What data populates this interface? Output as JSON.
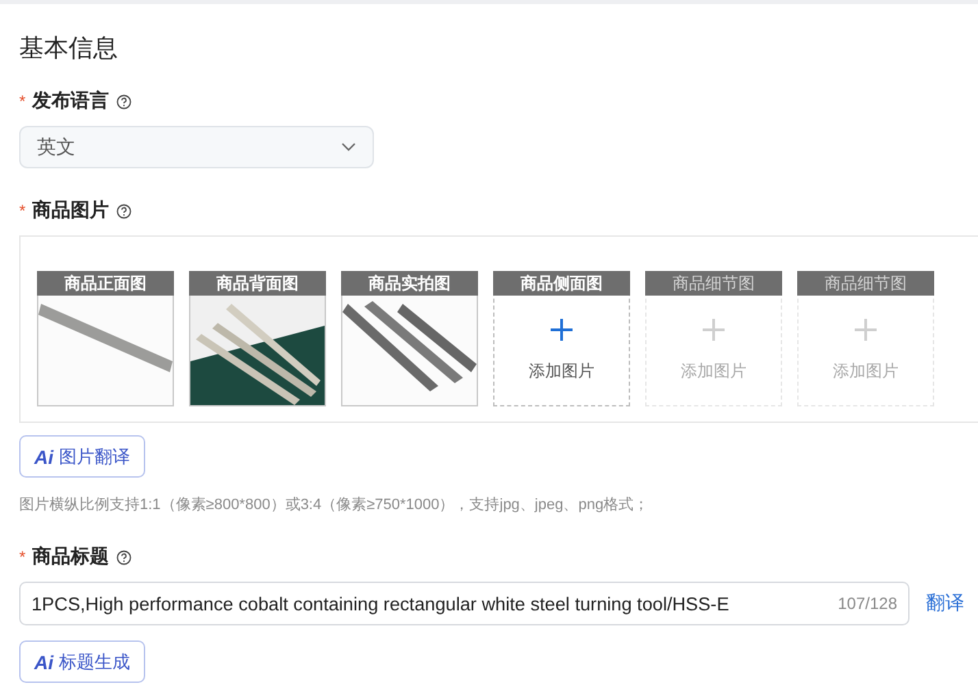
{
  "section_title": "基本信息",
  "language": {
    "mark": "*",
    "label": "发布语言",
    "value": "英文"
  },
  "images": {
    "mark": "*",
    "label": "商品图片",
    "slots": [
      {
        "caption": "商品正面图"
      },
      {
        "caption": "商品背面图"
      },
      {
        "caption": "商品实拍图"
      },
      {
        "caption": "商品侧面图",
        "kind": "empty",
        "add_label": "添加图片",
        "disabled": false
      },
      {
        "caption": "商品细节图",
        "kind": "empty",
        "add_label": "添加图片",
        "disabled": true
      },
      {
        "caption": "商品细节图",
        "kind": "empty",
        "add_label": "添加图片",
        "disabled": true
      }
    ],
    "ai_button": {
      "badge": "Ai",
      "label": "图片翻译"
    },
    "hint": "图片横纵比例支持1:1（像素≥800*800）或3:4（像素≥750*1000），支持jpg、jpeg、png格式；"
  },
  "title": {
    "mark": "*",
    "label": "商品标题",
    "value": "1PCS,High performance cobalt containing rectangular white steel turning tool/HSS-E",
    "count": "107/128",
    "translate": "翻译",
    "ai_button": {
      "badge": "Ai",
      "label": "标题生成"
    }
  }
}
